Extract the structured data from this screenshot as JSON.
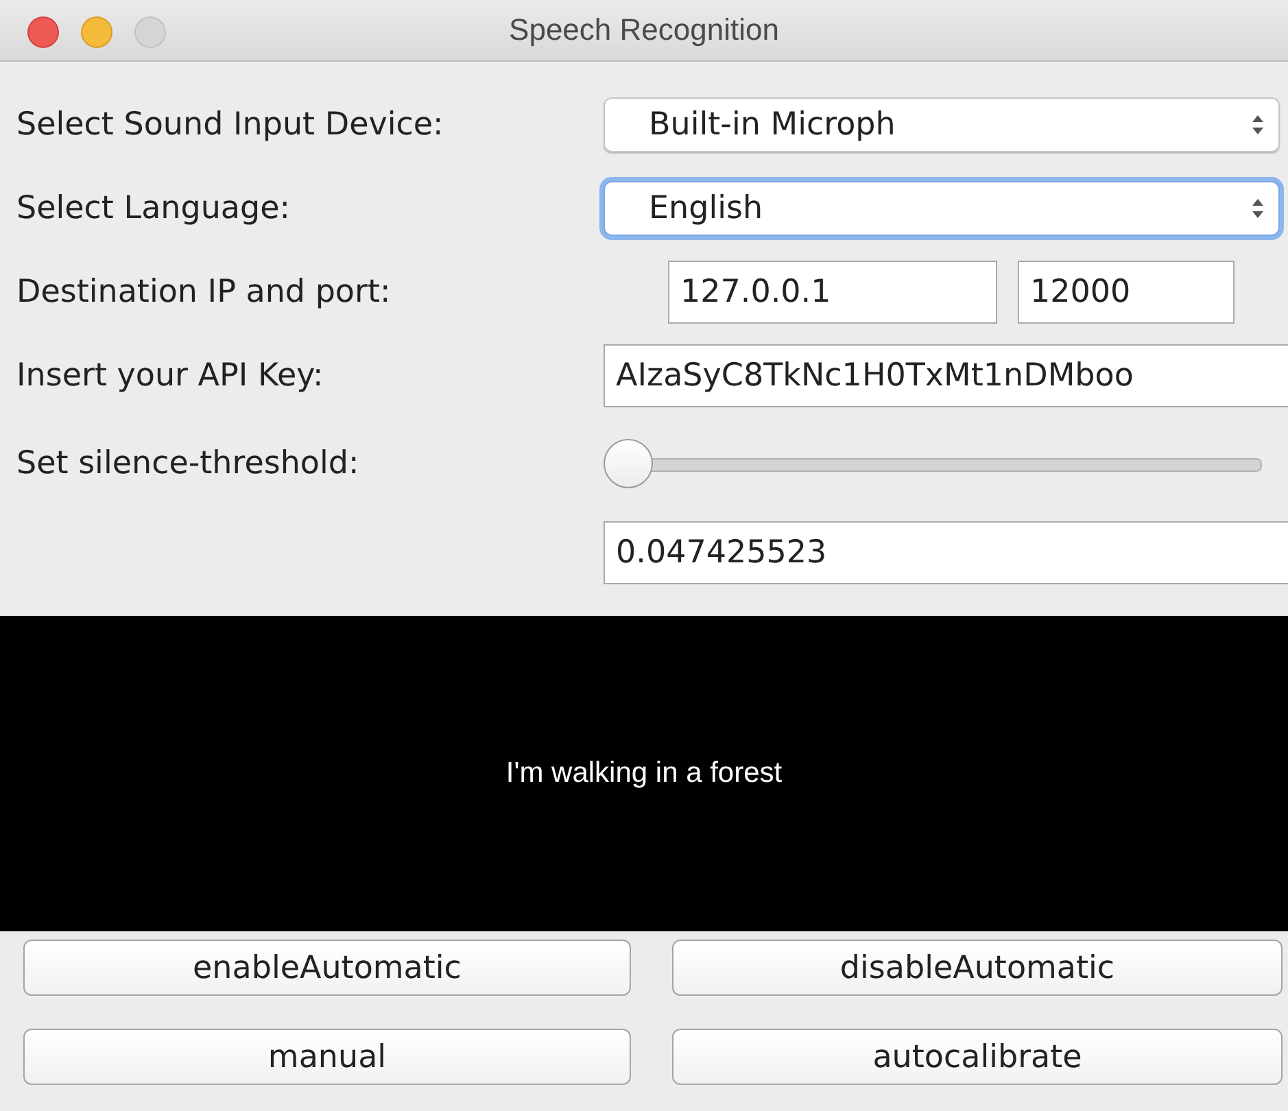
{
  "window": {
    "title": "Speech Recognition"
  },
  "form": [
    {
      "kind": "select",
      "label": "Select Sound Input Device:",
      "value": "Built-in Microph",
      "focused": false
    },
    {
      "kind": "select",
      "label": "Select Language:",
      "value": "English",
      "focused": true
    },
    {
      "kind": "pair",
      "label": "Destination IP and port:",
      "value": "127.0.0.1",
      "value_2": "12000"
    },
    {
      "kind": "text",
      "label": "Insert your API Key:",
      "value": "AIzaSyC8TkNc1H0TxMt1nDMboo"
    },
    {
      "kind": "slider",
      "label": "Set silence-threshold:",
      "level": 0
    },
    {
      "kind": "text",
      "value": "0.047425523"
    }
  ],
  "transcript": {
    "text": "I'm walking in a forest"
  },
  "buttons": [
    "enableAutomatic",
    "disableAutomatic",
    "manual",
    "autocalibrate"
  ]
}
